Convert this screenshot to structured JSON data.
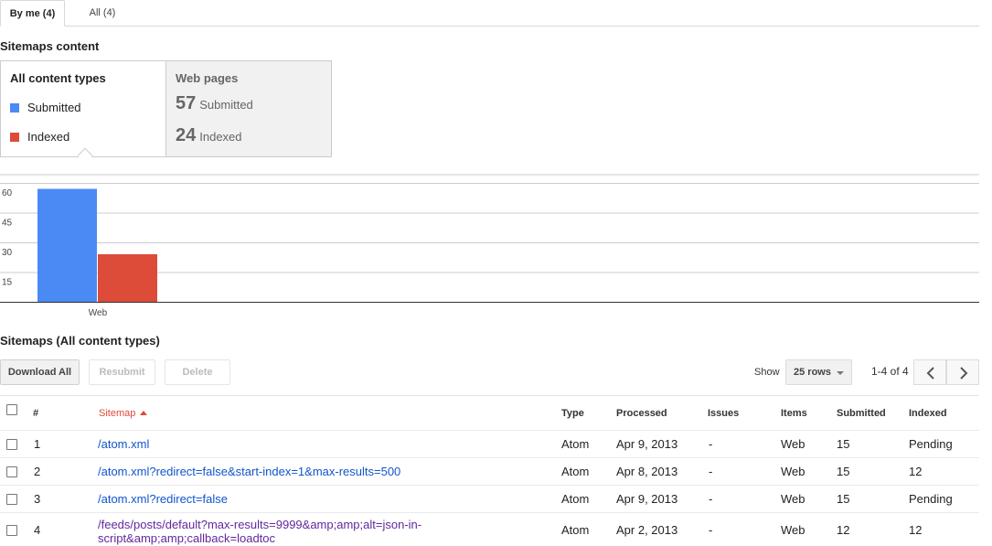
{
  "tabs": [
    {
      "label": "By me (4)",
      "active": true
    },
    {
      "label": "All (4)",
      "active": false
    }
  ],
  "sitemaps_content": {
    "title": "Sitemaps content",
    "content_types": {
      "header": "All content types",
      "legend": [
        {
          "label": "Submitted",
          "color": "#4a8af4"
        },
        {
          "label": "Indexed",
          "color": "#dd4b39"
        }
      ]
    },
    "web_pages": {
      "header": "Web pages",
      "submitted_value": "57",
      "submitted_label": "Submitted",
      "indexed_value": "24",
      "indexed_label": "Indexed"
    }
  },
  "chart_data": {
    "type": "bar",
    "categories": [
      "Web"
    ],
    "series": [
      {
        "name": "Submitted",
        "values": [
          57
        ],
        "color": "#4a8af4"
      },
      {
        "name": "Indexed",
        "values": [
          24
        ],
        "color": "#dd4b39"
      }
    ],
    "y_ticks": [
      15,
      30,
      45,
      60
    ],
    "ylim": [
      0,
      60
    ],
    "grid": true
  },
  "sitemaps_table": {
    "title": "Sitemaps (All content types)",
    "toolbar": {
      "download_all": "Download All",
      "resubmit": "Resubmit",
      "delete": "Delete",
      "show_label": "Show",
      "rows_option": "25 rows",
      "pager_text": "1-4 of 4"
    },
    "columns": [
      "#",
      "Sitemap",
      "Type",
      "Processed",
      "Issues",
      "Items",
      "Submitted",
      "Indexed"
    ],
    "rows": [
      {
        "num": "1",
        "sitemap": "/atom.xml",
        "sitemap2": "",
        "type": "Atom",
        "processed": "Apr 9, 2013",
        "issues": "-",
        "items": "Web",
        "submitted": "15",
        "indexed": "Pending"
      },
      {
        "num": "2",
        "sitemap": "/atom.xml?redirect=false&start-index=1&max-results=500",
        "sitemap2": "",
        "type": "Atom",
        "processed": "Apr 8, 2013",
        "issues": "-",
        "items": "Web",
        "submitted": "15",
        "indexed": "12"
      },
      {
        "num": "3",
        "sitemap": "/atom.xml?redirect=false",
        "sitemap2": "",
        "type": "Atom",
        "processed": "Apr 9, 2013",
        "issues": "-",
        "items": "Web",
        "submitted": "15",
        "indexed": "Pending"
      },
      {
        "num": "4",
        "sitemap": "/feeds/posts/default?max-results=9999&amp;amp;alt=json-in-",
        "sitemap2": "script&amp;amp;callback=loadtoc",
        "type": "Atom",
        "processed": "Apr 2, 2013",
        "issues": "-",
        "items": "Web",
        "submitted": "12",
        "indexed": "12"
      }
    ]
  }
}
